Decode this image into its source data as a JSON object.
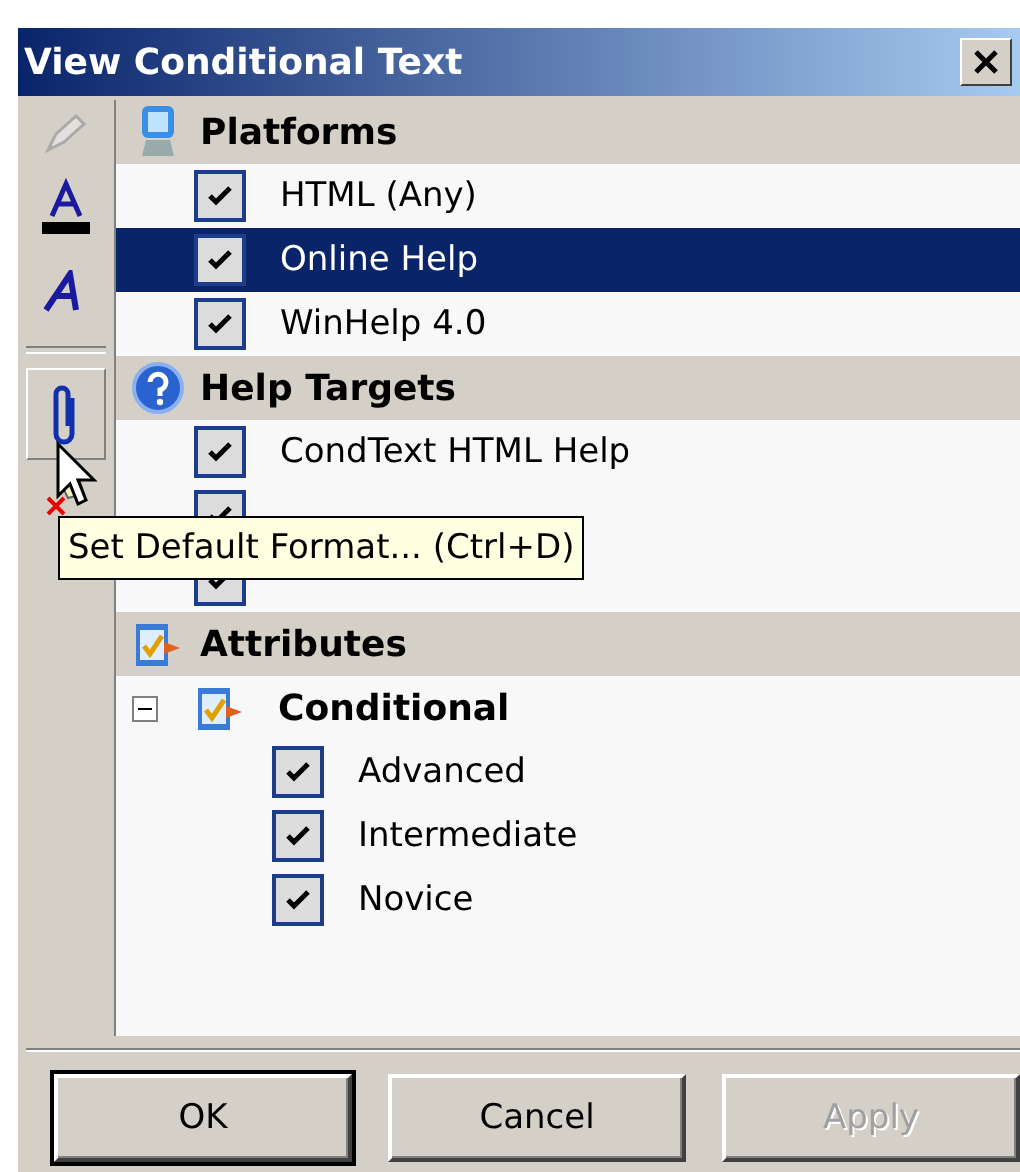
{
  "window": {
    "title": "View Conditional Text"
  },
  "toolbar": [
    {
      "kind": "pencil",
      "disabled": true,
      "pressed": false
    },
    {
      "kind": "underline-a",
      "disabled": false,
      "pressed": false
    },
    {
      "kind": "italic-a",
      "disabled": false,
      "pressed": false
    },
    {
      "kind": "separator"
    },
    {
      "kind": "paperclip",
      "disabled": false,
      "pressed": true
    },
    {
      "kind": "delete",
      "disabled": false,
      "pressed": false
    }
  ],
  "tree": [
    {
      "label": "Platforms",
      "kind": "computer",
      "items": [
        {
          "kind": "check",
          "label": "HTML (Any)",
          "checked": true,
          "selected": false
        },
        {
          "kind": "check",
          "label": "Online Help",
          "checked": true,
          "selected": true
        },
        {
          "kind": "check",
          "label": "WinHelp 4.0",
          "checked": true,
          "selected": false
        }
      ]
    },
    {
      "label": "Help Targets",
      "kind": "help",
      "items": [
        {
          "kind": "check",
          "label": "CondText HTML Help",
          "checked": true,
          "selected": false
        },
        {
          "kind": "check",
          "checked": true,
          "selected": false
        },
        {
          "kind": "check",
          "checked": true,
          "selected": false
        }
      ]
    },
    {
      "label": "Attributes",
      "kind": "attribute",
      "items": [
        {
          "kind": "group",
          "label": "Conditional",
          "expanded": true,
          "selected": false,
          "children": [
            {
              "kind": "check",
              "label": "Advanced",
              "checked": true,
              "selected": false
            },
            {
              "kind": "check",
              "label": "Intermediate",
              "checked": true,
              "selected": false
            },
            {
              "kind": "check",
              "label": "Novice",
              "checked": true,
              "selected": false
            }
          ]
        }
      ]
    }
  ],
  "tooltip": {
    "text": "Set Default Format... (Ctrl+D)"
  },
  "buttons": [
    {
      "label": "OK",
      "default": true,
      "disabled": false
    },
    {
      "label": "Cancel",
      "default": false,
      "disabled": false
    },
    {
      "label": "Apply",
      "default": false,
      "disabled": true
    }
  ]
}
